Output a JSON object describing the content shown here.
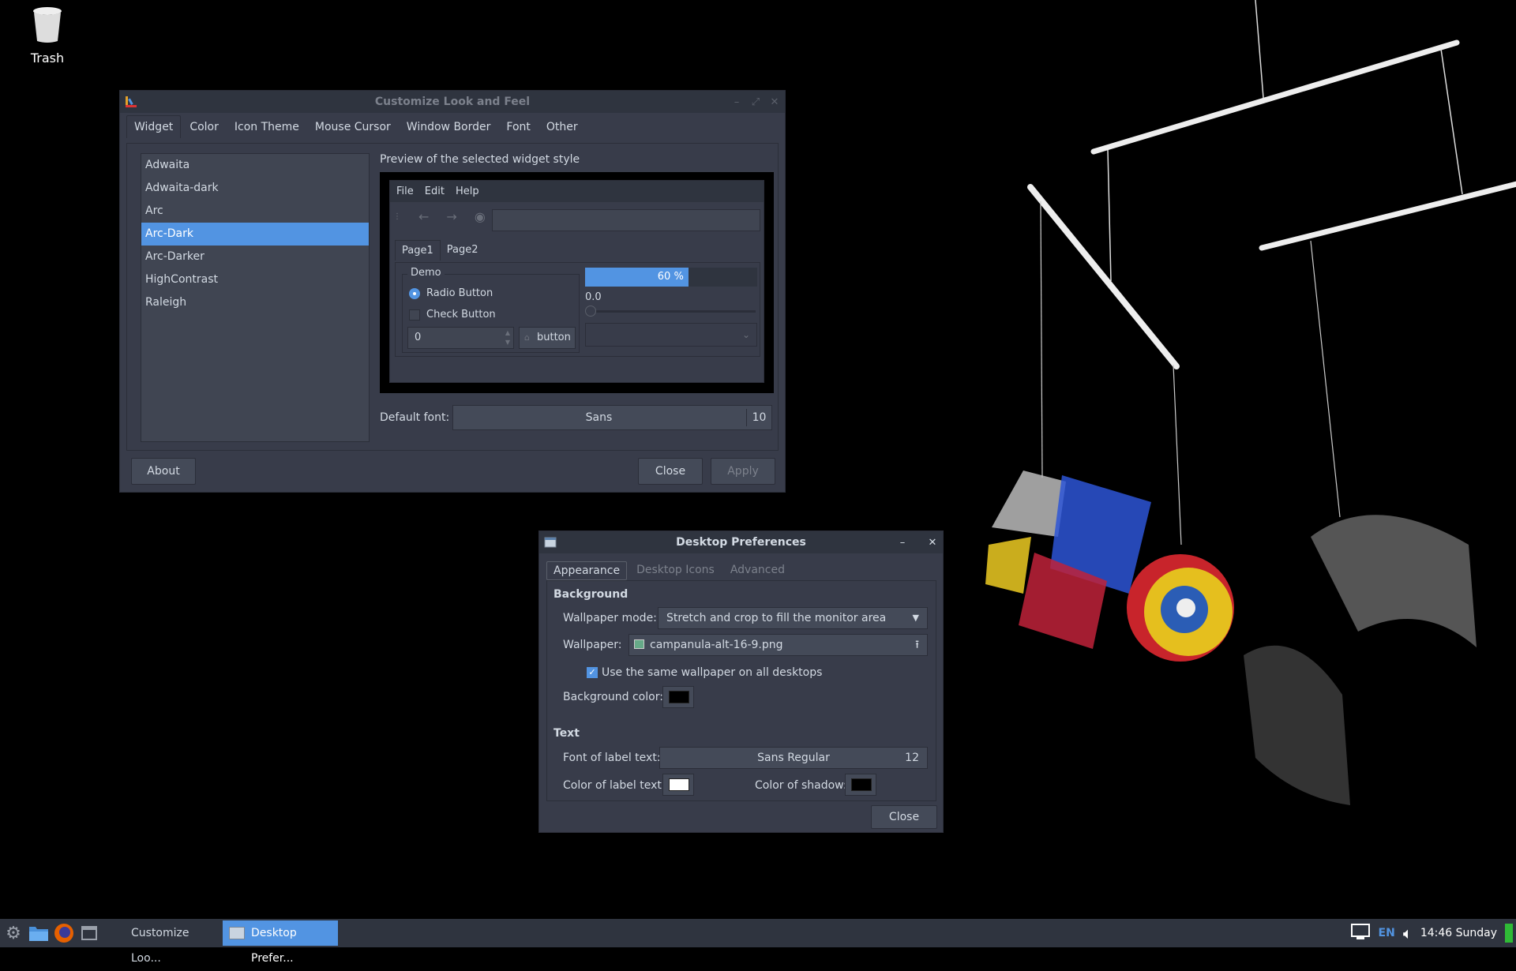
{
  "desktop": {
    "icons": [
      {
        "label": "Trash",
        "icon": "trash-icon"
      }
    ]
  },
  "customize": {
    "title": "Customize Look and Feel",
    "tabs": [
      "Widget",
      "Color",
      "Icon Theme",
      "Mouse Cursor",
      "Window Border",
      "Font",
      "Other"
    ],
    "active_tab": "Widget",
    "themes": [
      "Adwaita",
      "Adwaita-dark",
      "Arc",
      "Arc-Dark",
      "Arc-Darker",
      "HighContrast",
      "Raleigh"
    ],
    "selected_theme": "Arc-Dark",
    "preview_label": "Preview of the selected widget style",
    "preview": {
      "menu": [
        "File",
        "Edit",
        "Help"
      ],
      "tabs": [
        "Page1",
        "Page2"
      ],
      "demo_legend": "Demo",
      "radio_label": "Radio Button",
      "check_label": "Check Button",
      "spin_value": "0",
      "button_label": "button",
      "progress_fraction": 0.6,
      "progress_text": "60 %",
      "scale_value": "0.0"
    },
    "default_font_label": "Default font:",
    "default_font_name": "Sans",
    "default_font_size": "10",
    "about_label": "About",
    "close_label": "Close",
    "apply_label": "Apply"
  },
  "prefs": {
    "title": "Desktop Preferences",
    "tabs": [
      "Appearance",
      "Desktop Icons",
      "Advanced"
    ],
    "active_tab": "Appearance",
    "background_heading": "Background",
    "wallpaper_mode_label": "Wallpaper mode:",
    "wallpaper_mode_value": "Stretch and crop to fill the monitor area",
    "wallpaper_label": "Wallpaper:",
    "wallpaper_value": "campanula-alt-16-9.png",
    "same_wallpaper_label": "Use the same wallpaper on all desktops",
    "same_wallpaper_checked": true,
    "bg_color_label": "Background color:",
    "bg_color": "#000000",
    "text_heading": "Text",
    "font_label": "Font of label text:",
    "font_name": "Sans Regular",
    "font_size": "12",
    "label_color_label": "Color of label text:",
    "label_color": "#ffffff",
    "shadow_label": "Color of shadow:",
    "shadow_color": "#000000",
    "close_label": "Close"
  },
  "taskbar": {
    "tasks": [
      {
        "label": "Customize Loo...",
        "active": false
      },
      {
        "label": "Desktop Prefer...",
        "active": true
      }
    ],
    "lang": "EN",
    "clock": "14:46 Sunday"
  },
  "colors": {
    "accent": "#5294e2",
    "window_bg": "#383c4a",
    "titlebar": "#2f343f",
    "battery": "#2fbb36"
  }
}
